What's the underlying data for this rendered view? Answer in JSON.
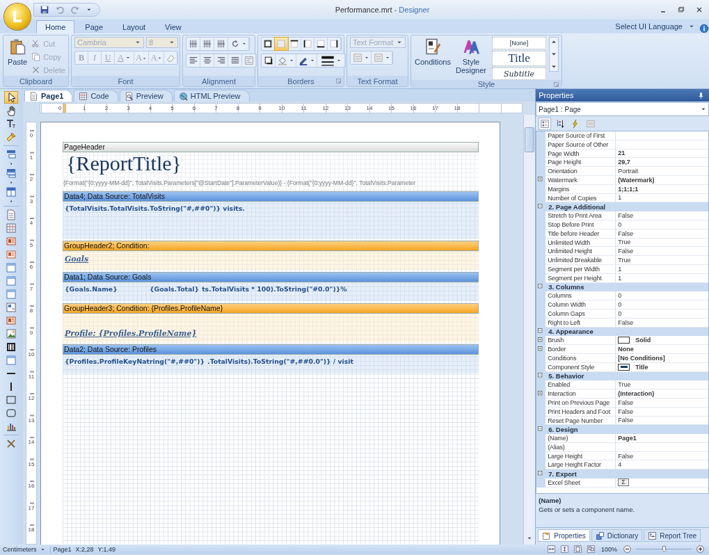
{
  "window": {
    "file": "Performance.mrt",
    "app": "- Designer"
  },
  "ribbon": {
    "tabs": [
      {
        "label": "Home",
        "selected": true
      },
      {
        "label": "Page",
        "selected": false
      },
      {
        "label": "Layout",
        "selected": false
      },
      {
        "label": "View",
        "selected": false
      }
    ],
    "language": "Select UI Language",
    "clipboard": {
      "label": "Clipboard",
      "paste": "Paste",
      "actions": [
        {
          "label": "Cut",
          "kind": "scissors",
          "disabled": true
        },
        {
          "label": "Copy",
          "kind": "copy",
          "disabled": true
        },
        {
          "label": "Delete",
          "kind": "delete",
          "disabled": true
        }
      ]
    },
    "font": {
      "label": "Font",
      "family": "Cambria",
      "size": "8",
      "disabled": true,
      "buttons": [
        {
          "label": "B",
          "kind": "bold"
        },
        {
          "label": "I",
          "kind": "italic"
        },
        {
          "label": "U",
          "kind": "underline"
        },
        {
          "label": "A",
          "kind": "color"
        },
        {
          "label": "A",
          "kind": "grow"
        },
        {
          "label": "A",
          "kind": "shrink"
        }
      ]
    },
    "alignment": {
      "label": "Alignment"
    },
    "borders": {
      "label": "Borders",
      "buttons": [
        {
          "kind": "all",
          "selected": false
        },
        {
          "kind": "none",
          "selected": true
        },
        {
          "kind": "top",
          "selected": false
        },
        {
          "kind": "left",
          "selected": false
        },
        {
          "kind": "bottom",
          "selected": false
        },
        {
          "kind": "right",
          "selected": false
        }
      ]
    },
    "text_format": {
      "label": "Text Format",
      "combo": "Text Format"
    },
    "style": {
      "label": "Style",
      "conditions": "Conditions",
      "designer": "Style Designer",
      "gallery": [
        {
          "label": "[None]",
          "kind": "none"
        },
        {
          "label": "Title",
          "kind": "title"
        },
        {
          "label": "Subtitle",
          "kind": "subtitle"
        }
      ]
    }
  },
  "toolbox": [
    [
      {
        "kind": "pointer",
        "selected": true,
        "submenu": false
      },
      {
        "kind": "hand",
        "selected": false,
        "submenu": false
      },
      {
        "kind": "text",
        "selected": false,
        "submenu": false
      },
      {
        "kind": "brush",
        "selected": false,
        "submenu": false
      }
    ],
    [
      {
        "kind": "band",
        "selected": false,
        "submenu": true
      },
      {
        "kind": "band-group",
        "selected": false,
        "submenu": true
      },
      {
        "kind": "cross-band",
        "selected": false,
        "submenu": true
      }
    ],
    [
      {
        "kind": "page",
        "selected": false,
        "submenu": false
      },
      {
        "kind": "table",
        "selected": false,
        "submenu": false
      },
      {
        "kind": "text-box",
        "selected": false,
        "submenu": false
      },
      {
        "kind": "rich-text",
        "selected": false,
        "submenu": false
      },
      {
        "kind": "panel",
        "selected": false,
        "submenu": false
      },
      {
        "kind": "panel",
        "selected": false,
        "submenu": false
      },
      {
        "kind": "panel",
        "selected": false,
        "submenu": false
      },
      {
        "kind": "text-frame",
        "selected": false,
        "submenu": false
      },
      {
        "kind": "text-box",
        "selected": false,
        "submenu": false
      },
      {
        "kind": "image",
        "selected": false,
        "submenu": false
      },
      {
        "kind": "barcode",
        "selected": false,
        "submenu": false
      },
      {
        "kind": "panel",
        "selected": false,
        "submenu": false
      },
      {
        "kind": "horizontal-line",
        "selected": false,
        "submenu": false
      },
      {
        "kind": "vertical-line",
        "selected": false,
        "submenu": false
      },
      {
        "kind": "rectangle",
        "selected": false,
        "submenu": false
      },
      {
        "kind": "rounded-rectangle",
        "selected": false,
        "submenu": false
      },
      {
        "kind": "chart",
        "selected": false,
        "submenu": false
      }
    ],
    [
      {
        "kind": "tools",
        "selected": false,
        "submenu": false
      }
    ]
  ],
  "document_tabs": [
    {
      "label": "Page1",
      "kind": "page",
      "selected": true
    },
    {
      "label": "Code",
      "kind": "table",
      "selected": false
    },
    {
      "label": "Preview",
      "kind": "preview",
      "selected": false
    },
    {
      "label": "HTML Preview",
      "kind": "globe",
      "selected": false
    }
  ],
  "rulers": {
    "horizontal": [
      "0",
      "1",
      "2",
      "3",
      "4",
      "5",
      "6",
      "7",
      "8",
      "9",
      "10",
      "11",
      "12",
      "13",
      "14",
      "15",
      "16",
      "17",
      "18"
    ],
    "vertical": [
      "0",
      "1",
      "2",
      "3",
      "4",
      "5",
      "6",
      "7",
      "8",
      "9",
      "10",
      "11",
      "12",
      "13",
      "14",
      "15",
      "16",
      "17",
      "18"
    ]
  },
  "bands": [
    {
      "title": "PageHeader",
      "kind": "page-header",
      "lines": [
        [
          {
            "text": "{ReportTitle}",
            "kind": "title"
          }
        ],
        [
          {
            "text": "{Format(\"{0:yyyy-MM-dd}\", TotalVisits.Parameters[\"@StartDate\"].ParameterValue)} - {Format(\"{0:yyyy-MM-dd}\", TotalVisits.Parameter",
            "kind": "formula"
          }
        ]
      ]
    },
    {
      "title": "Data4; Data Source: TotalVisits",
      "kind": "data",
      "lines": [
        [
          {
            "text": "{TotalVisits.TotalVisits.ToString(\"#,##0\")} visits.",
            "kind": "field"
          }
        ]
      ]
    },
    {
      "title": "GroupHeader2; Condition:",
      "kind": "group",
      "lines": [
        [
          {
            "text": "Goals",
            "kind": "heading"
          }
        ]
      ]
    },
    {
      "title": "Data1; Data Source: Goals",
      "kind": "data",
      "lines": [
        [
          {
            "text": "{Goals.Name}",
            "kind": "field"
          },
          {
            "text": "{Goals.Total}",
            "kind": "field"
          },
          {
            "text": "ts.TotalVisits * 100).ToString(\"#0.0\")}%",
            "kind": "field"
          }
        ]
      ]
    },
    {
      "title": "GroupHeader3; Condition: {Profiles.ProfileName}",
      "kind": "group",
      "lines": [
        [
          {
            "text": "Profile: {Profiles.ProfileName}",
            "kind": "heading"
          }
        ]
      ]
    },
    {
      "title": "Data2; Data Source: Profiles",
      "kind": "data",
      "lines": [
        [
          {
            "text": "{Profiles.ProfileKeyNatring(\"#,##0\")}",
            "kind": "field"
          },
          {
            "text": ".TotalVisits).ToString(\"#,##0.0\")} / visit",
            "kind": "field"
          }
        ]
      ]
    }
  ],
  "properties": {
    "title": "Properties",
    "selector": "Page1 : Page",
    "categories": [
      {
        "rows": [
          {
            "name": "Paper Source of First",
            "kind": "plain",
            "expandable": false
          },
          {
            "name": "Paper Source of Other",
            "kind": "plain",
            "expandable": false
          },
          {
            "name": "Page Width",
            "value": "21",
            "kind": "plain",
            "bold": true,
            "expandable": false
          },
          {
            "name": "Page Height",
            "value": "29,7",
            "kind": "plain",
            "bold": true,
            "expandable": false
          },
          {
            "name": "Orientation",
            "value": "Portrait",
            "kind": "plain",
            "bold": false,
            "expandable": false
          },
          {
            "name": "Watermark",
            "value": "(Watermark)",
            "kind": "plain",
            "bold": true,
            "expandable": true
          },
          {
            "name": "Margins",
            "value": "1;1;1;1",
            "kind": "plain",
            "bold": true,
            "expandable": false
          },
          {
            "name": "Number of Copies",
            "value": "1",
            "kind": "plain",
            "bold": false,
            "expandable": false
          }
        ]
      },
      {
        "title": "2. Page  Additional",
        "expanded": true,
        "rows": [
          {
            "name": "Stretch to Print Area",
            "value": "False",
            "kind": "plain",
            "bold": false,
            "expandable": false
          },
          {
            "name": "Stop Before Print",
            "value": "0",
            "kind": "plain",
            "bold": false,
            "expandable": false
          },
          {
            "name": "Title before Header",
            "value": "False",
            "kind": "plain",
            "bold": false,
            "expandable": false
          },
          {
            "name": "Unlimited Width",
            "value": "True",
            "kind": "plain",
            "bold": false,
            "expandable": false
          },
          {
            "name": "Unlimited Height",
            "value": "False",
            "kind": "plain",
            "bold": false,
            "expandable": false
          },
          {
            "name": "Unlimited Breakable",
            "value": "True",
            "kind": "plain",
            "bold": false,
            "expandable": false
          },
          {
            "name": "Segment per Width",
            "value": "1",
            "kind": "plain",
            "bold": false,
            "expandable": false
          },
          {
            "name": "Segment per Height",
            "value": "1",
            "kind": "plain",
            "bold": false,
            "expandable": false
          }
        ]
      },
      {
        "title": "3. Columns",
        "expanded": true,
        "rows": [
          {
            "name": "Columns",
            "value": "0",
            "kind": "plain",
            "bold": false,
            "expandable": false
          },
          {
            "name": "Column Width",
            "value": "0",
            "kind": "plain",
            "bold": false,
            "expandable": false
          },
          {
            "name": "Column Gaps",
            "value": "0",
            "kind": "plain",
            "bold": false,
            "expandable": false
          },
          {
            "name": "Right to Left",
            "value": "False",
            "kind": "plain",
            "bold": false,
            "expandable": false
          }
        ]
      },
      {
        "title": "4. Appearance",
        "expanded": true,
        "rows": [
          {
            "name": "Brush",
            "value": "Solid",
            "kind": "swatch",
            "bold": true,
            "expandable": true
          },
          {
            "name": "Border",
            "value": "None",
            "kind": "plain",
            "bold": true,
            "expandable": true
          },
          {
            "name": "Conditions",
            "value": "[No Conditions]",
            "kind": "plain",
            "bold": true,
            "expandable": false
          },
          {
            "name": "Component Style",
            "value": "Title",
            "kind": "style-swatch",
            "bold": true,
            "expandable": false
          }
        ]
      },
      {
        "title": "5. Behavior",
        "expanded": true,
        "rows": [
          {
            "name": "Enabled",
            "value": "True",
            "kind": "plain",
            "bold": false,
            "expandable": false
          },
          {
            "name": "Interaction",
            "value": "(Interaction)",
            "kind": "plain",
            "bold": true,
            "expandable": true
          },
          {
            "name": "Print on Previous Page",
            "value": "False",
            "kind": "plain",
            "bold": false,
            "expandable": false
          },
          {
            "name": "Print Headers and Foot",
            "value": "False",
            "kind": "plain",
            "bold": false,
            "expandable": false
          },
          {
            "name": "Reset Page Number",
            "value": "False",
            "kind": "plain",
            "bold": false,
            "expandable": false
          }
        ]
      },
      {
        "title": "6. Design",
        "expanded": true,
        "rows": [
          {
            "name": "(Name)",
            "value": "Page1",
            "kind": "plain",
            "bold": true,
            "expandable": false
          },
          {
            "name": "(Alias)",
            "kind": "plain",
            "expandable": false
          },
          {
            "name": "Large Height",
            "value": "False",
            "kind": "plain",
            "bold": false,
            "expandable": false
          },
          {
            "name": "Large Height Factor",
            "value": "4",
            "kind": "plain",
            "bold": false,
            "expandable": false
          }
        ]
      },
      {
        "title": "7. Export",
        "expanded": true,
        "rows": [
          {
            "name": "Excel Sheet",
            "value": "Σ",
            "kind": "button",
            "bold": false,
            "expandable": false
          }
        ]
      }
    ],
    "description": {
      "name": "(Name)",
      "text": "Gets or sets a component name."
    },
    "tabs": [
      {
        "label": "Properties",
        "kind": "properties",
        "selected": true
      },
      {
        "label": "Dictionary",
        "kind": "dictionary",
        "selected": false
      },
      {
        "label": "Report Tree",
        "kind": "tree",
        "selected": false
      }
    ]
  },
  "status_bar": {
    "units": "Centimeters",
    "page": "Page1",
    "x": "X:2,28",
    "y": "Y:1,49",
    "zoom": "100%",
    "zoom_slider": {
      "level": 0.5
    }
  }
}
